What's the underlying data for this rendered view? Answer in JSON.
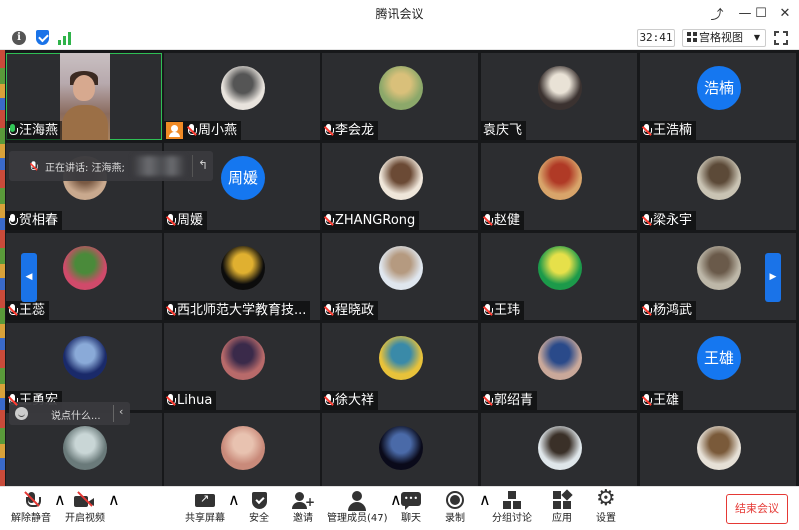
{
  "window": {
    "title": "腾讯会议"
  },
  "infobar": {
    "timer": "32:41",
    "view_label": "宫格视图"
  },
  "speaking": {
    "label": "正在讲话: 汪海燕;"
  },
  "chat": {
    "placeholder": "说点什么..."
  },
  "participants": [
    {
      "name": "汪海燕",
      "kind": "video",
      "mic": "on"
    },
    {
      "name": "周小燕",
      "kind": "photo",
      "bg": "#e8e3dd",
      "fg": "#555555",
      "mic": "muted",
      "host": true
    },
    {
      "name": "李会龙",
      "kind": "photo",
      "bg": "#8ca86a",
      "fg": "#d9c07a",
      "mic": "muted"
    },
    {
      "name": "袁庆飞",
      "kind": "photo",
      "bg": "#3b3230",
      "fg": "#e9e2d6",
      "mic": "none"
    },
    {
      "name": "王浩楠",
      "kind": "text",
      "avatar_text": "浩楠",
      "mic": "muted"
    },
    {
      "name": "贺相春",
      "kind": "photo",
      "bg": "#c9a98e",
      "fg": "#7a5a44",
      "mic": "white"
    },
    {
      "name": "周媛",
      "kind": "text",
      "avatar_text": "周媛",
      "mic": "muted"
    },
    {
      "name": "ZHANGRong",
      "kind": "photo",
      "bg": "#efe6da",
      "fg": "#6b4a35",
      "mic": "muted"
    },
    {
      "name": "赵健",
      "kind": "photo",
      "bg": "#d8a46a",
      "fg": "#b03a26",
      "mic": "muted"
    },
    {
      "name": "梁永宇",
      "kind": "photo",
      "bg": "#c9c3b3",
      "fg": "#5c4a38",
      "mic": "muted"
    },
    {
      "name": "王蕊",
      "kind": "photo",
      "bg": "#d04a6a",
      "fg": "#4a8a3a",
      "mic": "muted"
    },
    {
      "name": "西北师范大学教育技...",
      "kind": "photo",
      "bg": "#0c0c0c",
      "fg": "#e0b030",
      "mic": "muted"
    },
    {
      "name": "程晓政",
      "kind": "photo",
      "bg": "#dfe6ee",
      "fg": "#b59a80",
      "mic": "muted"
    },
    {
      "name": "王玮",
      "kind": "photo",
      "bg": "#1c9a4a",
      "fg": "#e6e04a",
      "mic": "muted"
    },
    {
      "name": "杨鸿武",
      "kind": "photo",
      "bg": "#bdb7a8",
      "fg": "#6a5a4a",
      "mic": "muted"
    },
    {
      "name": "王勇宏",
      "kind": "photo",
      "bg": "#1a2a6a",
      "fg": "#8aaad8",
      "mic": "muted"
    },
    {
      "name": "Lihua",
      "kind": "photo",
      "bg": "#b86a6a",
      "fg": "#3a2a4a",
      "mic": "muted"
    },
    {
      "name": "徐大祥",
      "kind": "photo",
      "bg": "#e8c23a",
      "fg": "#3a8aa8",
      "mic": "muted"
    },
    {
      "name": "郭绍青",
      "kind": "photo",
      "bg": "#c9a89a",
      "fg": "#2a4a8a",
      "mic": "muted"
    },
    {
      "name": "王雄",
      "kind": "text",
      "avatar_text": "王雄",
      "mic": "muted"
    },
    {
      "name": "",
      "kind": "photo",
      "bg": "#6a7a7a",
      "fg": "#c9d6d6",
      "mic": "none"
    },
    {
      "name": "",
      "kind": "photo",
      "bg": "#c98a7a",
      "fg": "#e8c2b0",
      "mic": "none"
    },
    {
      "name": "",
      "kind": "photo",
      "bg": "#0a0a1a",
      "fg": "#4a6aa8",
      "mic": "none"
    },
    {
      "name": "",
      "kind": "photo",
      "bg": "#dfe6ea",
      "fg": "#3a3028",
      "mic": "none"
    },
    {
      "name": "",
      "kind": "photo",
      "bg": "#e6e0d6",
      "fg": "#7a5a3a",
      "mic": "none"
    }
  ],
  "toolbar": {
    "unmute": "解除静音",
    "start_video": "开启视频",
    "share_screen": "共享屏幕",
    "security": "安全",
    "invite": "邀请",
    "manage_members": "管理成员(47)",
    "chat": "聊天",
    "record": "录制",
    "breakout": "分组讨论",
    "apps": "应用",
    "settings": "设置",
    "end_meeting": "结束会议"
  },
  "colors": {
    "accent": "#1a73e8",
    "end_meeting": "#e53935",
    "grid_bg": "#17181a",
    "tile_bg": "#2c2d30",
    "active_border": "#2fbf55"
  }
}
